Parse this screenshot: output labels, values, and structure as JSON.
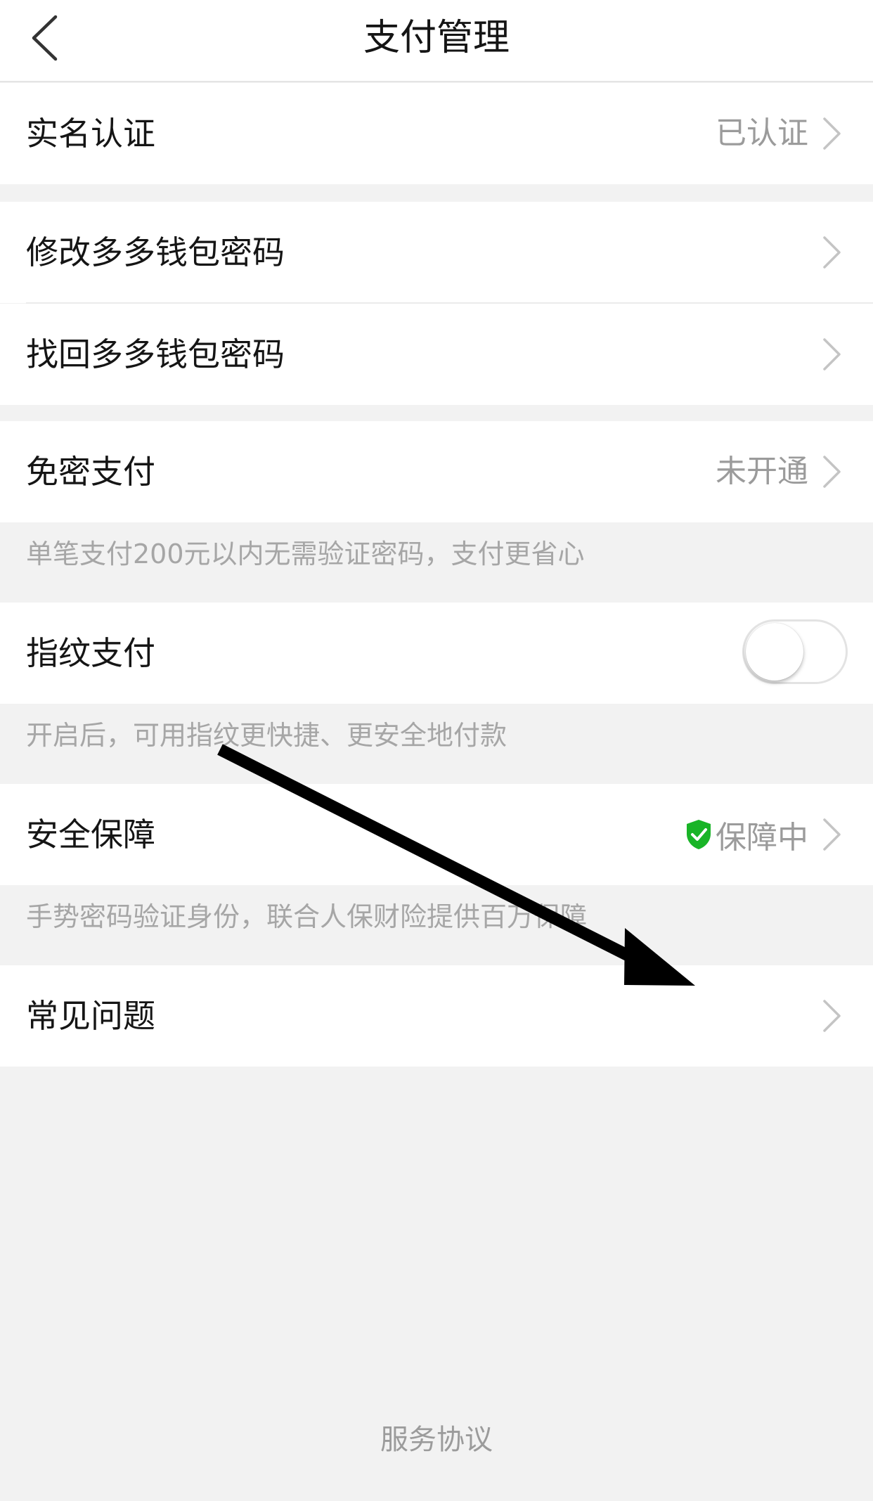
{
  "header": {
    "title": "支付管理"
  },
  "rows": {
    "real_name": {
      "label": "实名认证",
      "value": "已认证"
    },
    "change_password": {
      "label": "修改多多钱包密码"
    },
    "recover_password": {
      "label": "找回多多钱包密码"
    },
    "password_free": {
      "label": "免密支付",
      "value": "未开通",
      "note": "单笔支付200元以内无需验证密码，支付更省心"
    },
    "fingerprint": {
      "label": "指纹支付",
      "enabled": false,
      "note": "开启后，可用指纹更快捷、更安全地付款"
    },
    "security": {
      "label": "安全保障",
      "value": "保障中",
      "note": "手势密码验证身份，联合人保财险提供百万保障"
    },
    "faq": {
      "label": "常见问题"
    }
  },
  "footer": {
    "link": "服务协议"
  },
  "colors": {
    "shield": "#19b427",
    "page_background": "#f2f2f2"
  },
  "icons": {
    "back": "chevron-left-icon",
    "row_arrow": "chevron-right-icon",
    "shield": "shield-check-icon",
    "annotation": "arrow-annotation"
  }
}
